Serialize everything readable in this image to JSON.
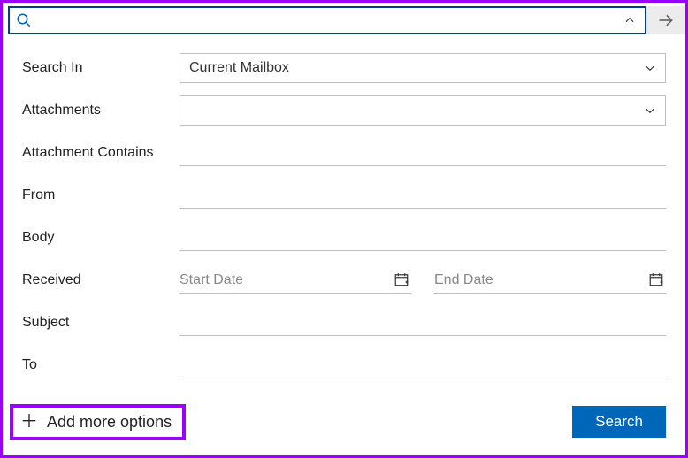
{
  "searchbar": {
    "value": ""
  },
  "labels": {
    "search_in": "Search In",
    "attachments": "Attachments",
    "attachment_contains": "Attachment Contains",
    "from": "From",
    "body": "Body",
    "received": "Received",
    "subject": "Subject",
    "to": "To"
  },
  "fields": {
    "search_in_value": "Current Mailbox",
    "attachments_value": "",
    "attachment_contains_value": "",
    "from_value": "",
    "body_value": "",
    "received_start_placeholder": "Start Date",
    "received_end_placeholder": "End Date",
    "subject_value": "",
    "to_value": ""
  },
  "footer": {
    "add_more": "Add more options",
    "search_button": "Search"
  }
}
